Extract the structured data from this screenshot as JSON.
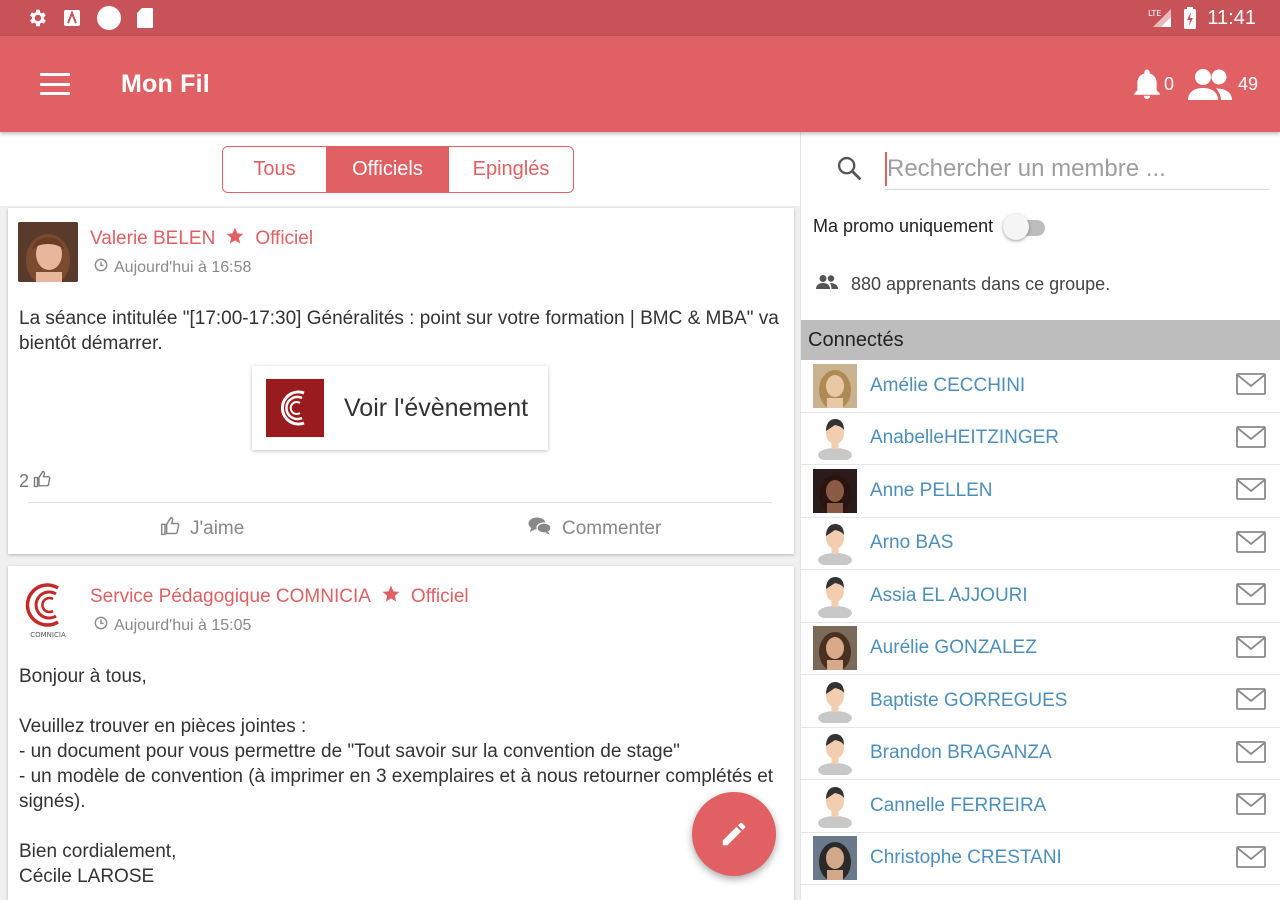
{
  "status_bar": {
    "time": "11:41",
    "network": "LTE"
  },
  "app_bar": {
    "title": "Mon Fil",
    "notifications": "0",
    "members": "49"
  },
  "tabs": [
    {
      "label": "Tous",
      "active": false
    },
    {
      "label": "Officiels",
      "active": true
    },
    {
      "label": "Epinglés",
      "active": false
    }
  ],
  "posts": [
    {
      "author": "Valerie BELEN",
      "badge": "Officiel",
      "time": "Aujourd'hui à 16:58",
      "body": "La séance intitulée \"[17:00-17:30] Généralités : point sur votre formation | BMC & MBA\" va bientôt démarrer.",
      "event_button": "Voir l'évènement",
      "likes": "2",
      "like_label": "J'aime",
      "comment_label": "Commenter"
    },
    {
      "author": "Service Pédagogique COMNICIA",
      "badge": "Officiel",
      "time": "Aujourd'hui à 15:05",
      "logo_text": "COMNICIA",
      "body": "Bonjour à tous,\n\nVeuillez trouver en pièces jointes :\n- un document pour vous permettre de \"Tout savoir sur la convention de stage\"\n- un modèle de convention (à imprimer en 3 exemplaires et à nous retourner complétés et signés).\n\nBien cordialement,\nCécile LAROSE"
    }
  ],
  "sidebar": {
    "search_placeholder": "Rechercher un membre ...",
    "promo_toggle_label": "Ma promo uniquement",
    "promo_toggle_on": false,
    "group_count": "880 apprenants dans ce groupe.",
    "section_title": "Connectés",
    "members": [
      {
        "name": "Amélie CECCHINI",
        "avatar": "photo"
      },
      {
        "name": "AnabelleHEITZINGER",
        "avatar": "default"
      },
      {
        "name": "Anne PELLEN",
        "avatar": "photo"
      },
      {
        "name": "Arno BAS",
        "avatar": "default"
      },
      {
        "name": "Assia EL AJJOURI",
        "avatar": "default"
      },
      {
        "name": "Aurélie GONZALEZ",
        "avatar": "photo"
      },
      {
        "name": "Baptiste GORREGUES",
        "avatar": "default"
      },
      {
        "name": "Brandon BRAGANZA",
        "avatar": "default"
      },
      {
        "name": "Cannelle FERREIRA",
        "avatar": "default"
      },
      {
        "name": "Christophe CRESTANI",
        "avatar": "photo"
      }
    ]
  },
  "colors": {
    "primary": "#e06063",
    "status_bar": "#c75257",
    "link": "#4d8fbc",
    "brand_dark": "#9a1b1e"
  }
}
